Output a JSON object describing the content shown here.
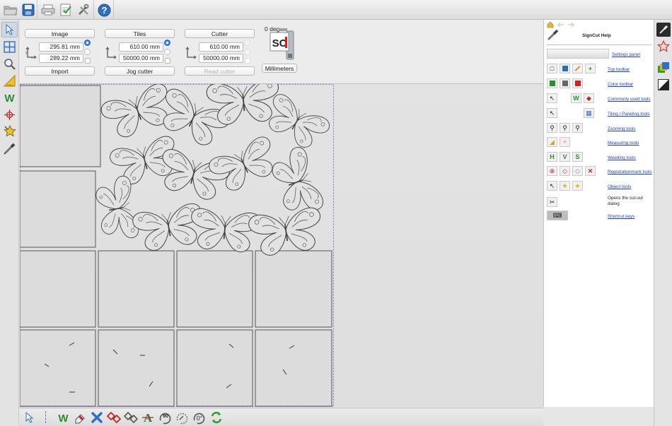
{
  "top_toolbar": {
    "icons": [
      "open-folder-icon",
      "save-icon",
      "print-icon",
      "checklist-icon",
      "tools-icon",
      "help-icon"
    ]
  },
  "left_toolbar": {
    "icons": [
      "select-arrow-icon",
      "tiles-grid-icon",
      "zoom-icon",
      "measure-icon",
      "weed-w-icon",
      "registration-mark-icon",
      "star-object-icon",
      "cutter-knife-icon"
    ]
  },
  "image_panel": {
    "title": "Image",
    "x_value": "295.81 mm",
    "y_value": "289.22 mm",
    "import_label": "Import"
  },
  "tiles_panel": {
    "title": "Tiles",
    "x_value": "610.00 mm",
    "y_value": "50000.00 mm",
    "jog_label": "Jog cutter"
  },
  "cutter_panel": {
    "title": "Cutter",
    "x_value": "610.00 mm",
    "y_value": "50000.00 mm",
    "read_label": "Read cutter"
  },
  "rotation": {
    "label": "0 deg",
    "logo_text": "SC",
    "units_label": "Millimeters"
  },
  "help_panel": {
    "title": "SignCut Help",
    "items": [
      {
        "label": "Settings panel",
        "link": true
      },
      {
        "label": "Top toolbar",
        "link": true
      },
      {
        "label": "Color toolbar",
        "link": true
      },
      {
        "label": "Commonly used tools",
        "link": true
      },
      {
        "label": "Tiling / Paneling tools",
        "link": true
      },
      {
        "label": "Zooming tools",
        "link": true
      },
      {
        "label": "Measuring tools",
        "link": true
      },
      {
        "label": "Weeding tools",
        "link": true
      },
      {
        "label": "Registrationmark tools",
        "link": true
      },
      {
        "label": "Object tools",
        "link": true
      },
      {
        "label": "Opens the cut-out dialog",
        "link": false
      },
      {
        "label": "Shortcut keys",
        "link": true
      }
    ]
  },
  "bottom_toolbar": {
    "rotate_90_label": "90",
    "rotate_0_label": "0°"
  },
  "colors": {
    "accent_blue": "#2f7cf6",
    "link_blue": "#1a3fd0",
    "weed_green": "#2e8b2e",
    "mark_red": "#d42020",
    "canvas_bg": "#e0e0e0",
    "shape_stroke": "#555555"
  }
}
